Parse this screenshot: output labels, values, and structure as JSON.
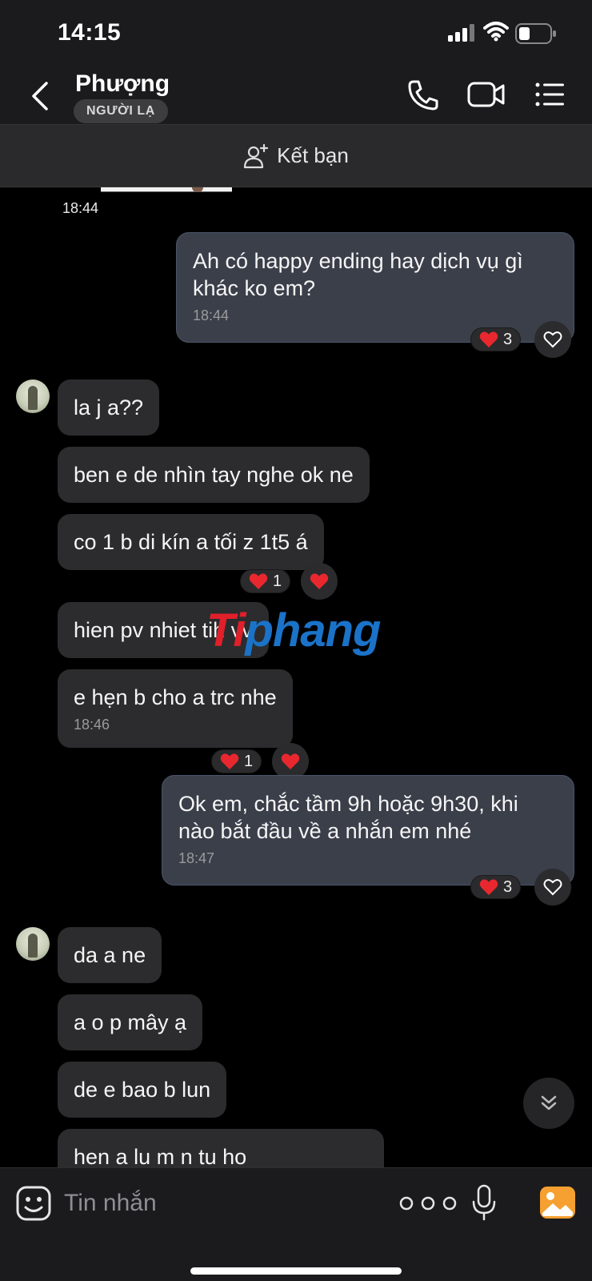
{
  "status_bar": {
    "time": "14:15"
  },
  "header": {
    "contact_name": "Phượng",
    "badge": "NGƯỜI LẠ"
  },
  "friend_bar": {
    "label": "Kết bạn"
  },
  "messages": {
    "image_time": "18:44",
    "m1": {
      "text": "Ah có happy ending hay dịch vụ gì khác ko em?",
      "time": "18:44",
      "reaction_count": "3"
    },
    "m2": {
      "text": "la j a??"
    },
    "m3": {
      "text": "ben e de nhìn tay nghe ok ne"
    },
    "m4": {
      "text": "co 1 b di kín a tối z 1t5 á",
      "reaction_count": "1"
    },
    "m5": {
      "text": "hien pv nhiet tih vv"
    },
    "m6": {
      "text": "e hẹn b cho a trc nhe",
      "time": "18:46",
      "reaction_count": "1"
    },
    "m7": {
      "text": "Ok em, chắc tầm 9h hoặc 9h30, khi nào bắt đầu về a nhắn em nhé",
      "time": "18:47",
      "reaction_count": "3"
    },
    "m8": {
      "text": "da a ne"
    },
    "m9": {
      "text": "a o p mây ạ"
    },
    "m10": {
      "text": "de e bao b lun"
    },
    "m11": {
      "text": "hen a lu    m    n    tu    ho"
    }
  },
  "watermark": {
    "part1": "Ti",
    "part2": "phang"
  },
  "input": {
    "placeholder": "Tin nhắn"
  },
  "colors": {
    "background": "#000000",
    "bar": "#1b1b1d",
    "incoming_bubble": "#2c2c2e",
    "outgoing_bubble": "#3a3f4a",
    "heart": "#e8282e",
    "photo_accent": "#f5a030"
  },
  "icons": [
    "back-icon",
    "call-icon",
    "video-icon",
    "menu-icon",
    "add-friend-icon",
    "heart-icon",
    "sticker-icon",
    "more-icon",
    "mic-icon",
    "photo-icon",
    "chevron-double-down-icon"
  ]
}
